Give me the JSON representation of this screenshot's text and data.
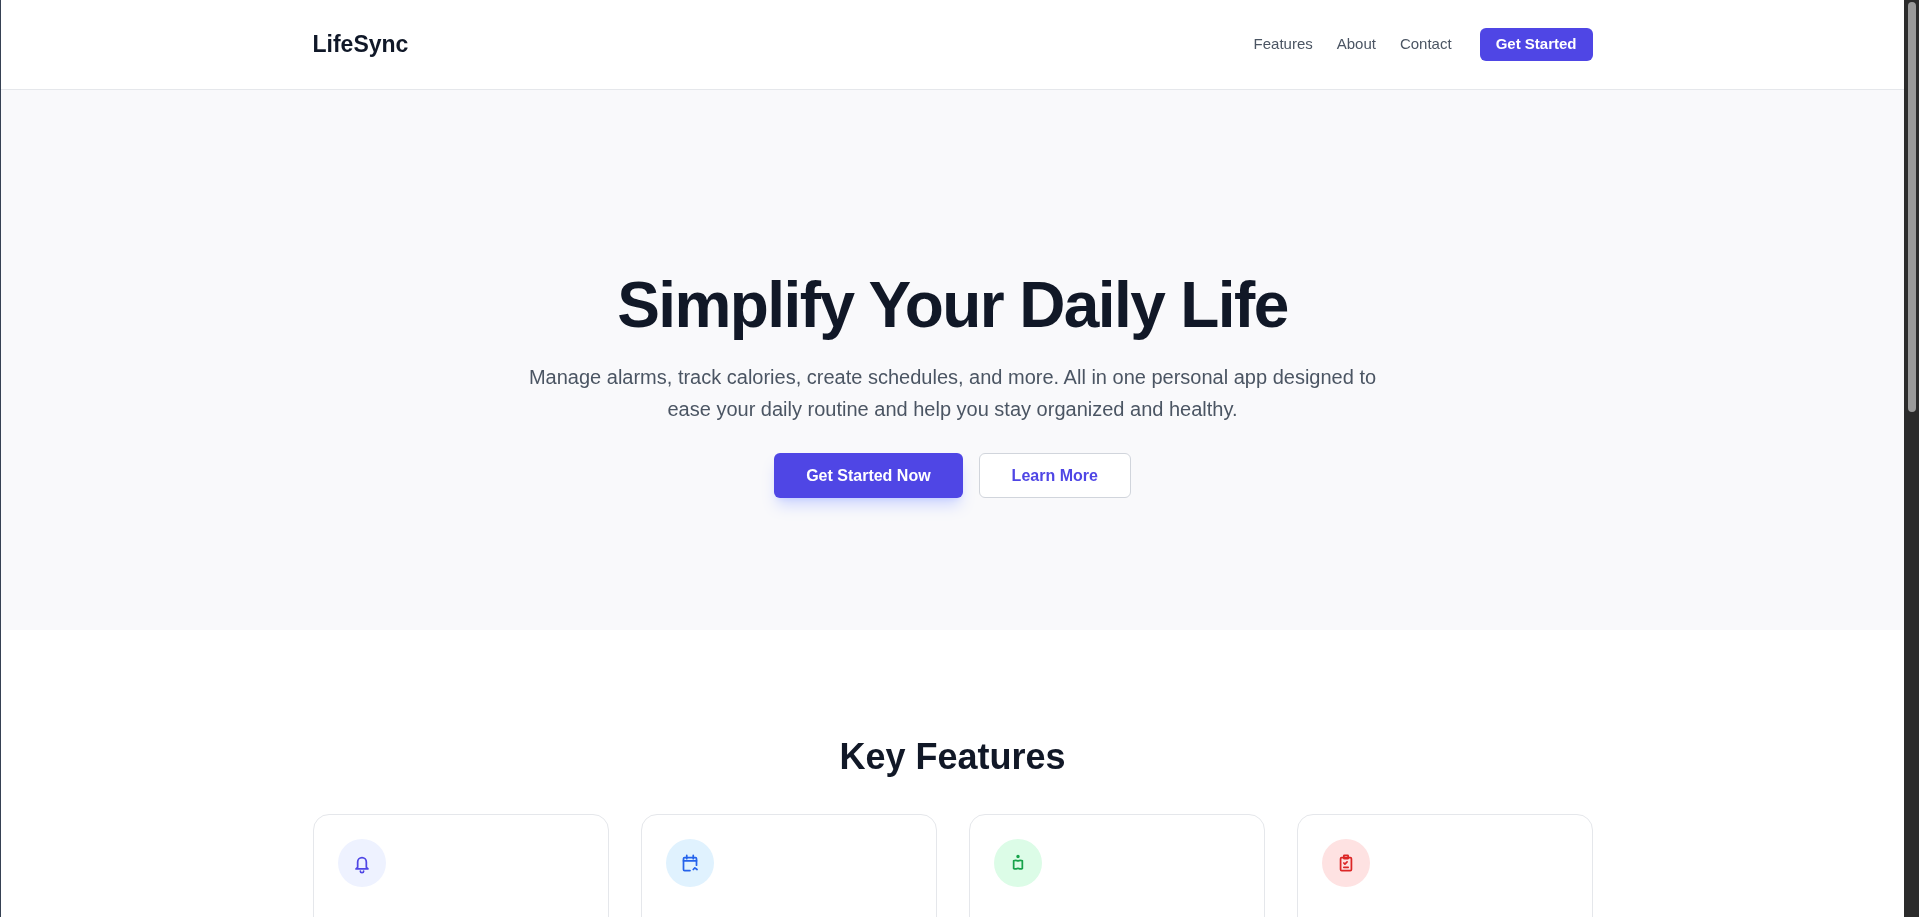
{
  "header": {
    "logo": "LifeSync",
    "nav": [
      "Features",
      "About",
      "Contact"
    ],
    "cta": "Get Started"
  },
  "hero": {
    "title": "Simplify Your Daily Life",
    "subtitle": "Manage alarms, track calories, create schedules, and more. All in one personal app designed to ease your daily routine and help you stay organized and healthy.",
    "primary_button": "Get Started Now",
    "secondary_button": "Learn More"
  },
  "features": {
    "title": "Key Features",
    "cards": [
      {
        "kind": "bell"
      },
      {
        "kind": "calendar"
      },
      {
        "kind": "apple"
      },
      {
        "kind": "clipboard"
      }
    ]
  }
}
